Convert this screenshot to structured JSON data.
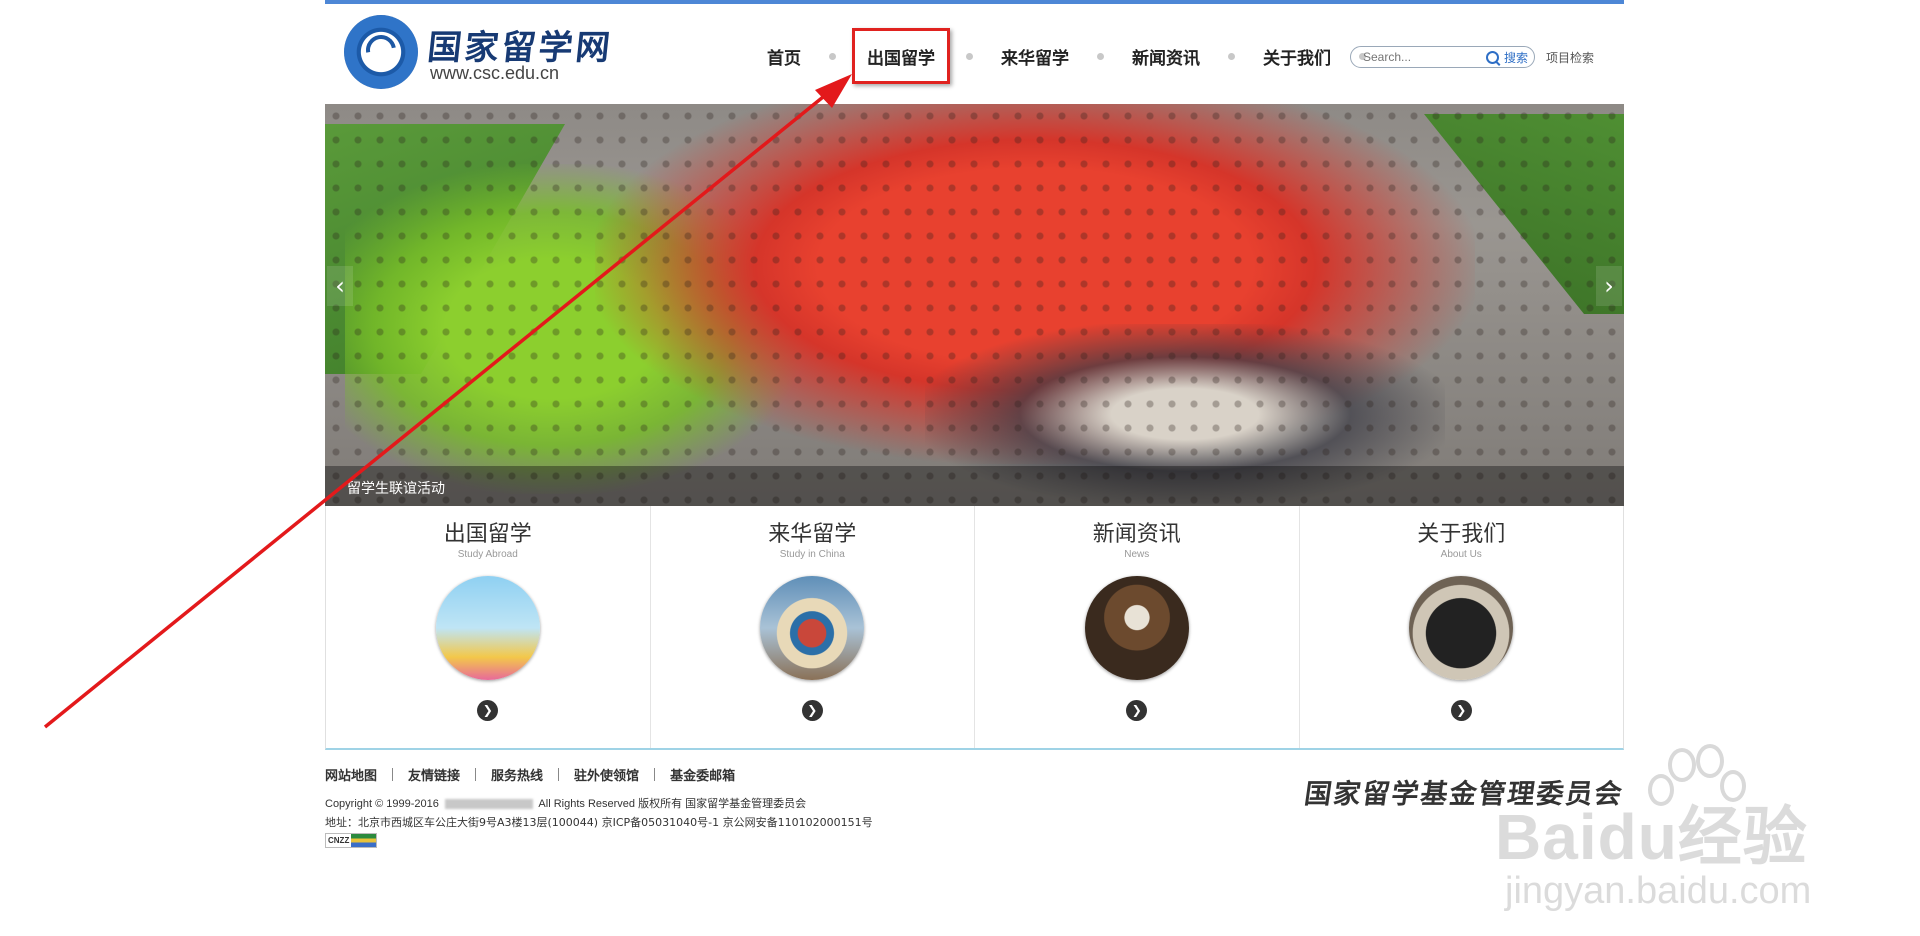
{
  "header": {
    "logo_title": "国家留学网",
    "logo_url": "www.csc.edu.cn",
    "nav": [
      "首页",
      "出国留学",
      "来华留学",
      "新闻资讯",
      "关于我们"
    ],
    "highlighted_nav": "出国留学",
    "search_placeholder": "Search...",
    "search_button": "搜索",
    "project_search": "项目检索"
  },
  "banner": {
    "caption": "留学生联谊活动",
    "prev_icon": "‹",
    "next_icon": "›"
  },
  "features": [
    {
      "title": "出国留学",
      "subtitle": "Study Abroad",
      "icon": "chevron-right-icon"
    },
    {
      "title": "来华留学",
      "subtitle": "Study in China",
      "icon": "chevron-right-icon"
    },
    {
      "title": "新闻资讯",
      "subtitle": "News",
      "icon": "chevron-right-icon"
    },
    {
      "title": "关于我们",
      "subtitle": "About Us",
      "icon": "chevron-right-icon"
    }
  ],
  "footer": {
    "links": [
      "网站地图",
      "友情链接",
      "服务热线",
      "驻外使领馆",
      "基金委邮箱"
    ],
    "copyright_prefix": "Copyright © 1999-2016",
    "copyright_suffix": "All Rights Reserved   版权所有   国家留学基金管理委员会",
    "address": "地址：北京市西城区车公庄大街9号A3楼13层(100044)  京ICP备05031040号-1    京公网安备110102000151号",
    "cnzz": "CNZZ",
    "foundation_name": "国家留学基金管理委员会"
  },
  "watermark": {
    "brand": "Baidu经验",
    "url": "jingyan.baidu.com"
  },
  "colors": {
    "accent_blue": "#4d87d6",
    "highlight_red": "#e0221f",
    "feature_border": "#9fd3e6"
  }
}
